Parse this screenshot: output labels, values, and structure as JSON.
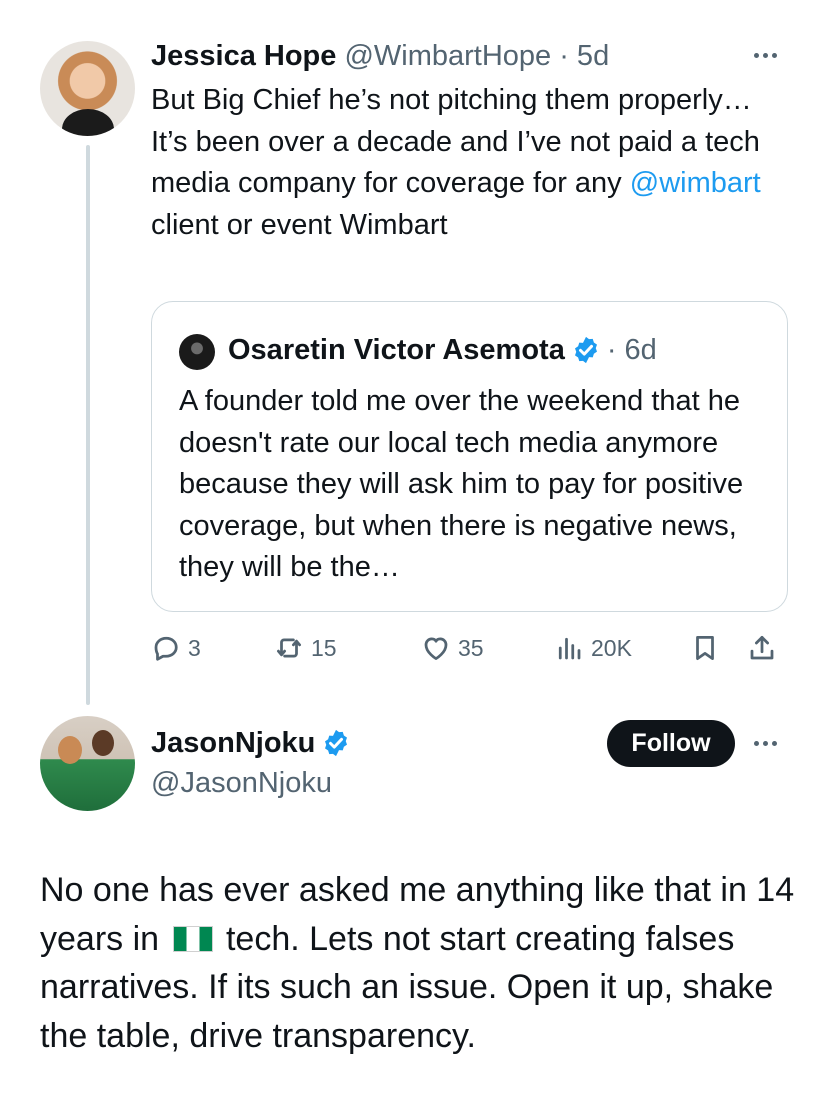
{
  "tweet": {
    "author_name": "Jessica Hope",
    "handle_meta": "@WimbartHope · 5d",
    "text_before": "But Big Chief he’s not pitching them properly…\nIt’s been over a decade and I’ve not paid a tech media company for coverage for any ",
    "mention": "@wimbart",
    "text_after": " client or event Wimbart",
    "quote": {
      "author_name": "Osaretin Victor Asemota",
      "time": "· 6d",
      "text": "A founder told me over the weekend that he doesn't rate our local tech media anymore because they will ask him to pay for positive coverage, but when there is negative news, they will be the…"
    },
    "actions": {
      "replies": "3",
      "reposts": "15",
      "likes": "35",
      "views": "20K"
    }
  },
  "reply": {
    "author_name": "JasonNjoku",
    "handle": "@JasonNjoku",
    "follow_label": "Follow",
    "text_before": "No one has ever asked me anything like that in 14 years in",
    "flag": "Nigeria flag",
    "text_after": " tech. Lets not start creating falses narratives. If its such an issue. Open it up, shake the table, drive transparency."
  },
  "colors": {
    "accent": "#1d9bf0",
    "text": "#0f1419",
    "muted": "#536471",
    "border": "#cfd9de"
  }
}
